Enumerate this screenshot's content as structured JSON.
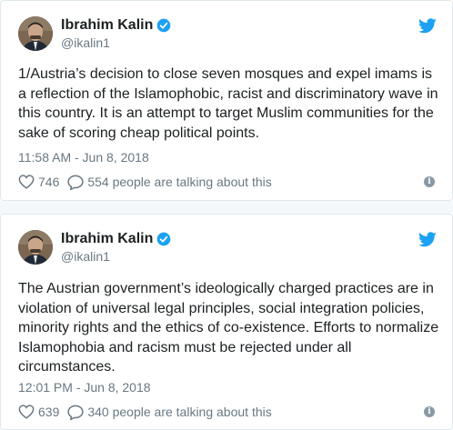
{
  "colors": {
    "twitter_blue": "#1da1f2",
    "text": "#1c2022",
    "secondary_text": "#697882",
    "border": "#e1e8ed"
  },
  "icons": {
    "brand": "twitter-bird-icon",
    "verified": "verified-badge-icon",
    "like": "heart-icon",
    "reply": "speech-bubble-icon",
    "info": "info-icon"
  },
  "tweets": [
    {
      "author": {
        "name": "Ibrahim Kalin",
        "handle": "@ikalin1",
        "verified": true
      },
      "text": "1/Austria’s decision to close seven mosques and expel imams is a reflection of the Islamophobic, racist and discriminatory wave in this country. It is an attempt to target Muslim communities for the sake of scoring cheap political points.",
      "timestamp": "11:58 AM - Jun 8, 2018",
      "likes": "746",
      "talking": "554 people are talking about this"
    },
    {
      "author": {
        "name": "Ibrahim Kalin",
        "handle": "@ikalin1",
        "verified": true
      },
      "text": "The Austrian government’s ideologically charged practices are in violation of universal legal principles, social integration policies, minority rights and the ethics of co-existence. Efforts to normalize Islamophobia and racism must be rejected under all circumstances.",
      "timestamp": "12:01 PM - Jun 8, 2018",
      "likes": "639",
      "talking": "340 people are talking about this"
    }
  ]
}
